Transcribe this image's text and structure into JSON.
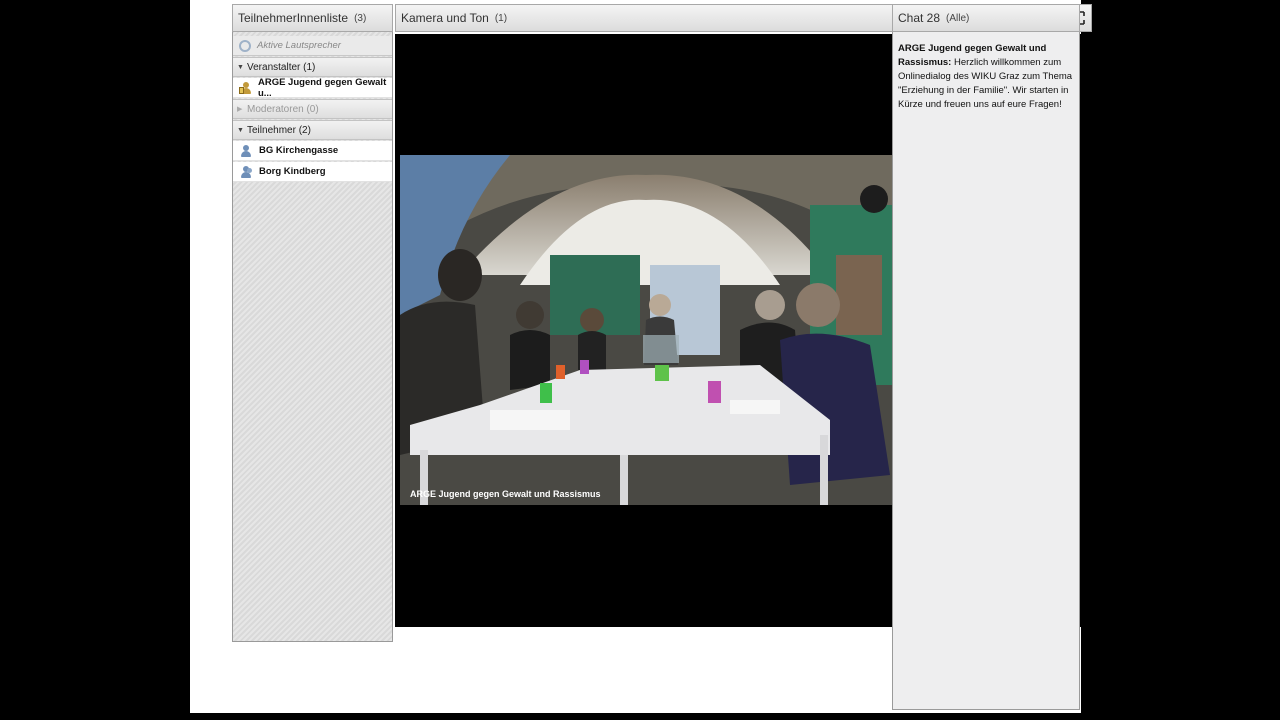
{
  "attendees": {
    "title": "TeilnehmerInnenliste",
    "count": "(3)",
    "active_speakers": "Aktive Lautsprecher",
    "groups": [
      {
        "label": "Veranstalter (1)",
        "users": [
          "ARGE Jugend gegen Gewalt u..."
        ]
      },
      {
        "label": "Moderatoren (0)",
        "users": []
      },
      {
        "label": "Teilnehmer (2)",
        "users": [
          "BG Kirchengasse",
          "Borg Kindberg"
        ]
      }
    ]
  },
  "camera": {
    "title": "Kamera und Ton",
    "count": "(1)",
    "video_caption": "ARGE Jugend gegen Gewalt und Rassismus"
  },
  "chat": {
    "title": "Chat 28",
    "scope": "(Alle)",
    "messages": [
      {
        "sender": "ARGE Jugend gegen Gewalt und Rassismus:",
        "text": "Herzlich willkommen zum Onlinedialog des WIKU Graz zum Thema \"Erziehung in der Familie\". Wir starten in Kürze und freuen uns auf eure Fragen!"
      }
    ]
  },
  "colors": {
    "background": "#000000",
    "pod_header": "#dcdcdc",
    "chat_bg": "#eeeeef",
    "user_icon": "#6f8fb8",
    "host_icon": "#c29a3a"
  }
}
